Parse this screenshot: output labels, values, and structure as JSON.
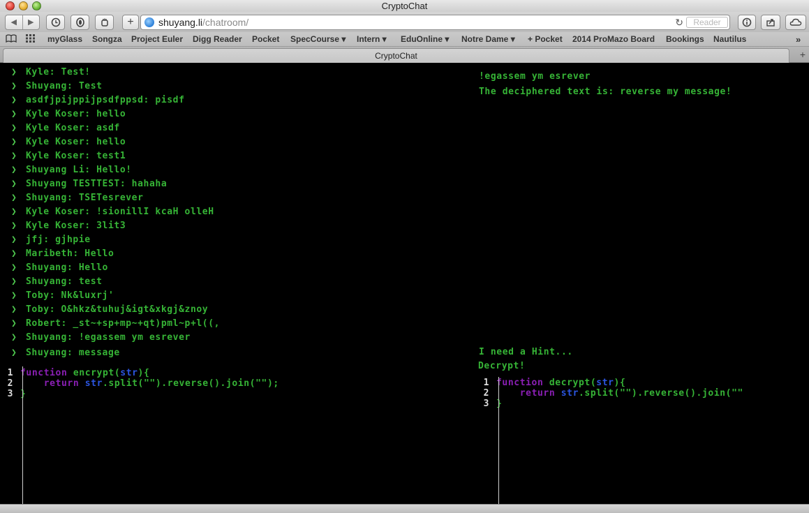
{
  "window": {
    "title": "CryptoChat"
  },
  "toolbar": {
    "back": "◀",
    "forward": "▶",
    "history_icon": "clock-icon",
    "privacy_icon": "hand-icon",
    "add": "+",
    "url_host": "shuyang.li",
    "url_path": "/chatroom/",
    "reload": "↻",
    "reader": "Reader"
  },
  "bookmarks": [
    {
      "label": "myGlass"
    },
    {
      "label": "Songza"
    },
    {
      "label": "Project Euler"
    },
    {
      "label": "Digg Reader"
    },
    {
      "label": "Pocket"
    },
    {
      "label": "SpecCourse ▾"
    },
    {
      "label": "Intern ▾"
    },
    {
      "label": "EduOnline ▾"
    },
    {
      "label": "Notre Dame ▾"
    },
    {
      "label": "+ Pocket"
    },
    {
      "label": "2014 ProMazo Board"
    },
    {
      "label": "Bookings"
    },
    {
      "label": "Nautilus"
    }
  ],
  "tab": {
    "title": "CryptoChat"
  },
  "chat": {
    "messages": [
      "Kyle: Test!",
      "Shuyang: Test",
      "asdfjpijppijpsdfppsd: pisdf",
      "Kyle Koser: hello",
      "Kyle Koser: asdf",
      "Kyle Koser: hello",
      "Kyle Koser: test1",
      "Shuyang Li: Hello!",
      "Shuyang TESTTEST: hahaha",
      "Shuyang: TSETesrever",
      "Kyle Koser: !sionillI kcaH olleH",
      "Kyle Koser: 3lit3",
      "jfj: gjhpie",
      "Maribeth: Hello",
      "Shuyang: Hello",
      "Shuyang: test",
      "Toby: Nk&luxrj'",
      "Toby: O&hkz&tuhuj&igt&xkgj&znoy",
      "Robert: _st~+sp+mp~+qt)pml~p+l((,",
      "Shuyang: !egassem ym esrever"
    ],
    "input_line": "Shuyang: message",
    "arrow": "❯"
  },
  "decrypt_output": {
    "ciphertext": "!egassem ym esrever",
    "result": "The deciphered text is: reverse my message!"
  },
  "actions": {
    "hint": "I need a Hint...",
    "decrypt": "Decrypt!"
  },
  "encrypt_editor": {
    "line_numbers": [
      "1",
      "2",
      "3"
    ],
    "l1_kw": "function",
    "l1_name": " encrypt(",
    "l1_arg": "str",
    "l1_end": "){",
    "l2_kw": "return",
    "l2_var": "str",
    "l2_rest": ".split(\"\").reverse().join(\"\");",
    "l3": "}"
  },
  "decrypt_editor": {
    "line_numbers": [
      "1",
      "2",
      "3"
    ],
    "l1_kw": "function",
    "l1_name": " decrypt(",
    "l1_arg": "str",
    "l1_end": "){",
    "l2_kw": "return",
    "l2_var": "str",
    "l2_rest": ".split(\"\").reverse().join(\"\"",
    "l3": "}"
  }
}
